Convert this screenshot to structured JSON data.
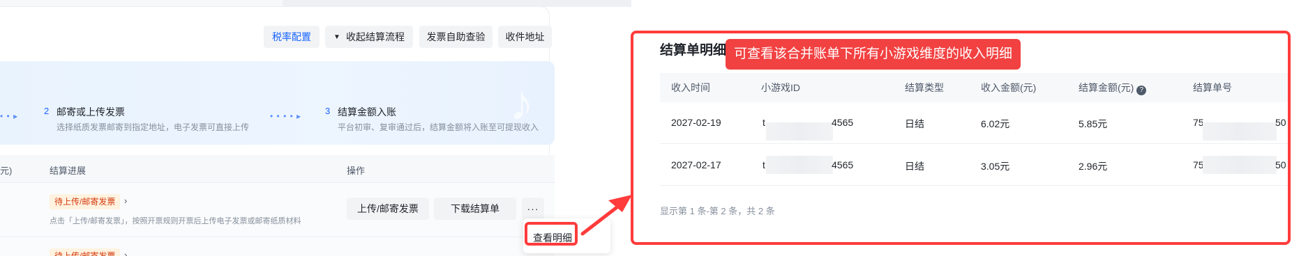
{
  "toolbar": {
    "tax_rate_config": "税率配置",
    "collapse_flow": "收起结算流程",
    "invoice_check": "发票自助查验",
    "address": "收件地址"
  },
  "steps": [
    {
      "num": "2",
      "title": "邮寄或上传发票",
      "desc": "选择纸质发票邮寄到指定地址，电子发票可直接上传"
    },
    {
      "num": "3",
      "title": "结算金额入账",
      "desc": "平台初审、复审通过后，结算金额将入账至可提现收入"
    }
  ],
  "left_table": {
    "col_amount_tail": "元)",
    "col_progress": "结算进展",
    "col_action": "操作",
    "rows": [
      {
        "status": "待上传/邮寄发票",
        "desc": "点击「上传/邮寄发票」，按照开票规则开票后上传电子发票或邮寄纸质材料",
        "upload_btn": "上传/邮寄发票",
        "download_btn": "下载结算单",
        "more_btn": "···"
      },
      {
        "status": "待上传/邮寄发票"
      }
    ]
  },
  "popover": {
    "view_detail": "查看明细"
  },
  "right": {
    "title": "结算单明细",
    "callout": "可查看该合并账单下所有小游戏维度的收入明细",
    "headers": [
      "收入时间",
      "小游戏ID",
      "结算类型",
      "收入金额(元)",
      "结算金额(元)",
      "结算单号"
    ],
    "help_icon": "?",
    "rows": [
      {
        "date": "2027-02-19",
        "id_head": "t",
        "id_tail": "4565",
        "type": "日结",
        "income": "6.02元",
        "settle": "5.85元",
        "no_head": "75",
        "no_tail": "50"
      },
      {
        "date": "2027-02-17",
        "id_head": "t",
        "id_tail": "4565",
        "type": "日结",
        "income": "3.05元",
        "settle": "2.96元",
        "no_head": "75",
        "no_tail": "50"
      }
    ],
    "footer": "显示第 1 条-第 2 条，共 2 条"
  },
  "colors": {
    "annotation_red": "#ff3b3b",
    "link_blue": "#1664ff",
    "badge_bg": "#fff3e0",
    "badge_text": "#d4380d"
  }
}
